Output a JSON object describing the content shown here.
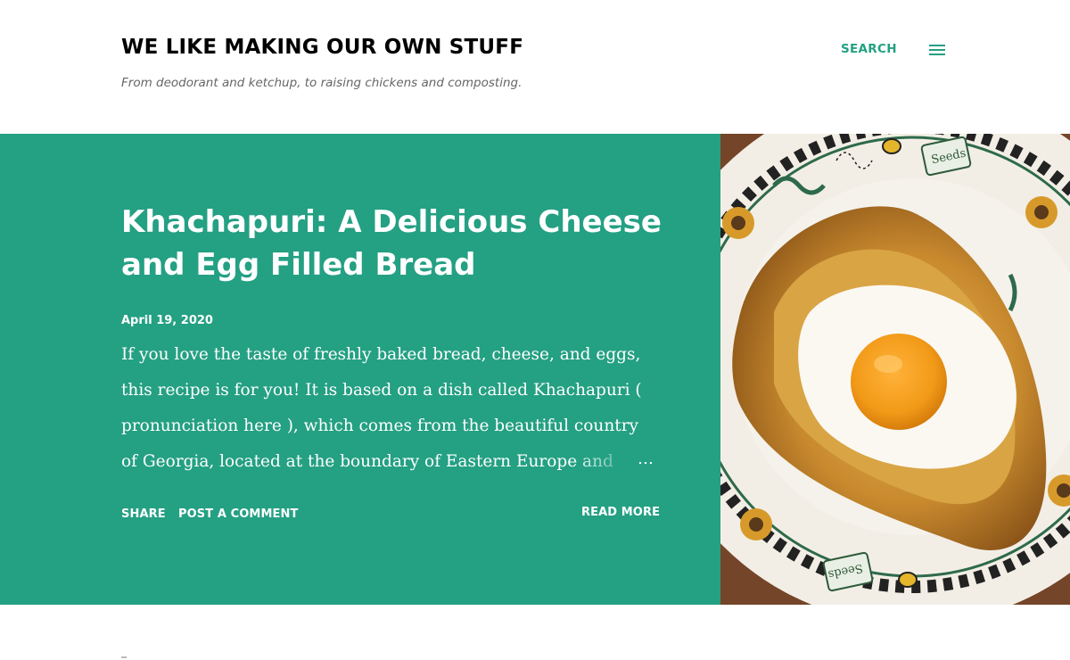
{
  "header": {
    "blog_title": "WE LIKE MAKING OUR OWN STUFF",
    "description": "From deodorant and ketchup, to raising chickens and composting.",
    "search_label": "SEARCH",
    "menu_icon": "hamburger-menu-icon"
  },
  "post": {
    "title": "Khachapuri: A Delicious Cheese and Egg Filled Bread",
    "date": "April 19, 2020",
    "snippet": "If you love the taste of freshly baked bread, cheese, and eggs, this recipe is for you!  It is based on a dish called Khachapuri ( pronunciation here ), which comes from the beautiful country of Georgia, located at the boundary of Eastern Europe and Asia.",
    "ellipsis": "…",
    "share_label": "SHARE",
    "comment_label": "POST A COMMENT",
    "read_more_label": "READ MORE",
    "image_alt": "Khachapuri bread with a fried egg on a decorated plate"
  },
  "colors": {
    "accent": "#24a083",
    "title_text": "#000000",
    "description_text": "#666666",
    "hero_text": "#ffffff"
  }
}
